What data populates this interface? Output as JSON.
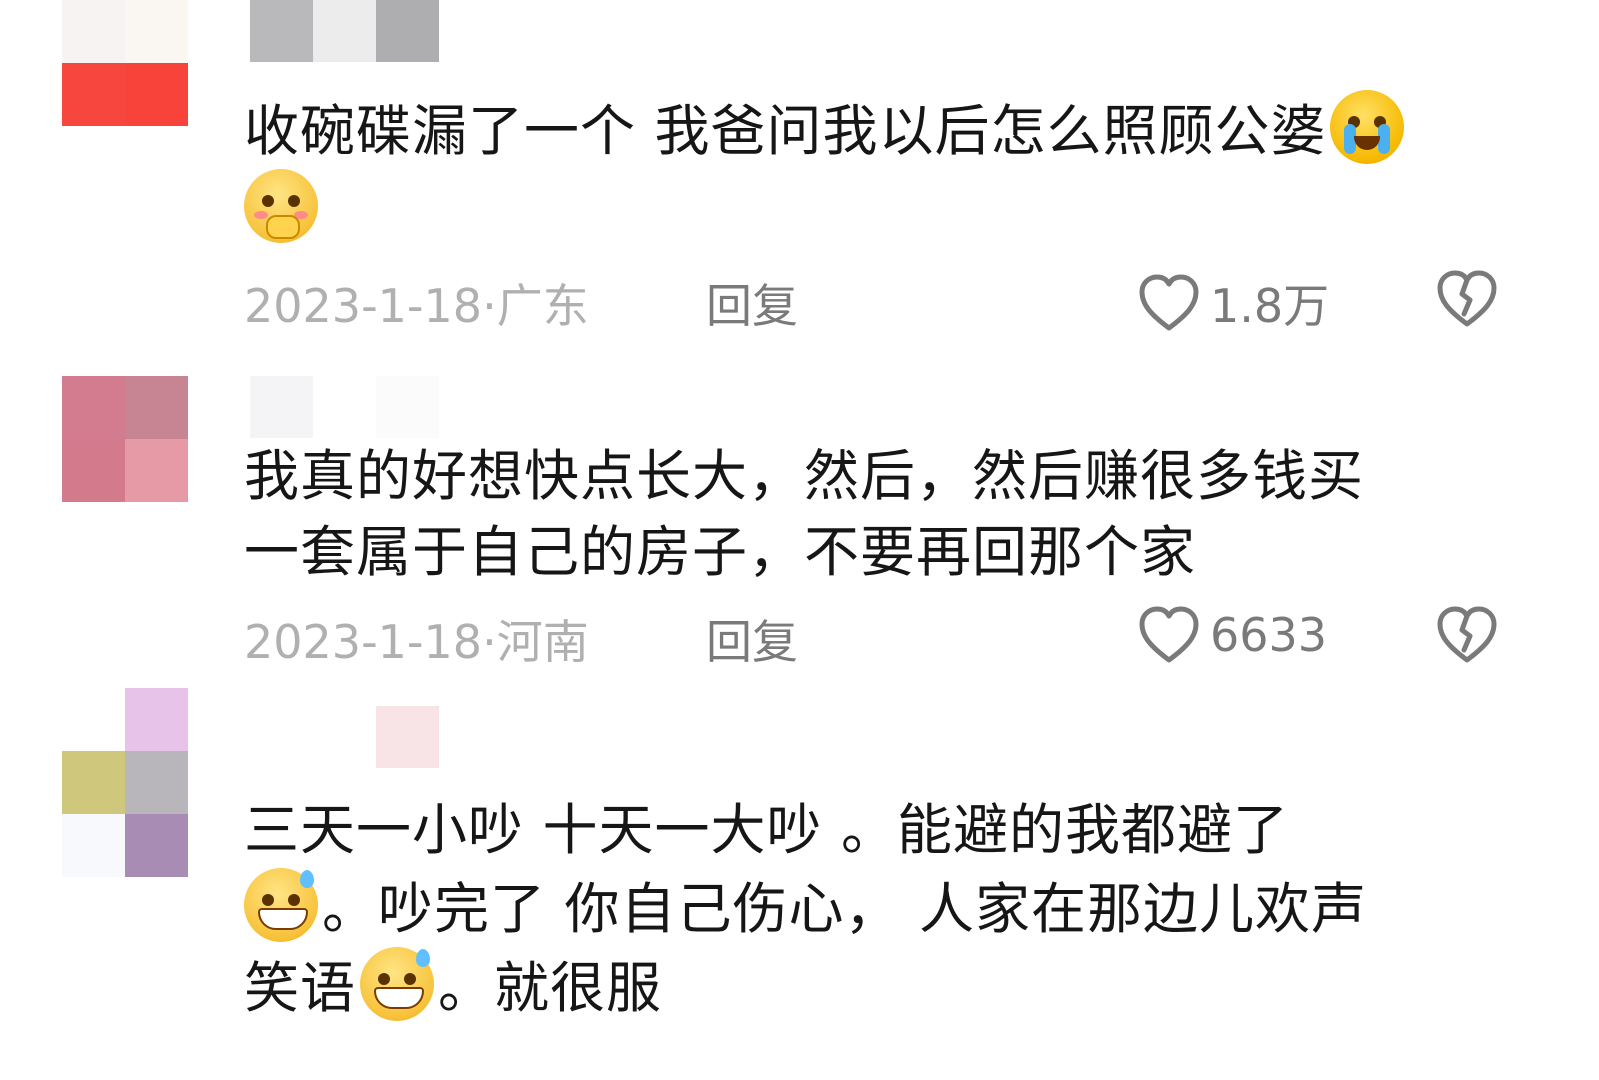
{
  "comments": [
    {
      "text_line1": "收碗碟漏了一个 我爸问我以后怎么照顾公婆",
      "emoji_1": "crying-face-icon",
      "emoji_2": "pleading-face-icon",
      "date": "2023-1-18·",
      "location": "广东",
      "reply_label": "回复",
      "like_count": "1.8万"
    },
    {
      "text_line1": "我真的好想快点长大，然后，然后赚很多钱买",
      "text_line2": "一套属于自己的房子，不要再回那个家",
      "date": "2023-1-18·",
      "location": "河南",
      "reply_label": "回复",
      "like_count": "6633"
    },
    {
      "text_line1": "三天一小吵 十天一大吵 。能避的我都避了",
      "text_line2": "。吵完了 你自己伤心， 人家在那边儿欢声",
      "text_line3_a": "笑语",
      "text_line3_b": "。就很服",
      "emoji": "grinning-sweat-face-icon"
    }
  ],
  "colors": {
    "text": "#161616",
    "meta": "#b0b0b0",
    "action": "#7a7a7a"
  }
}
